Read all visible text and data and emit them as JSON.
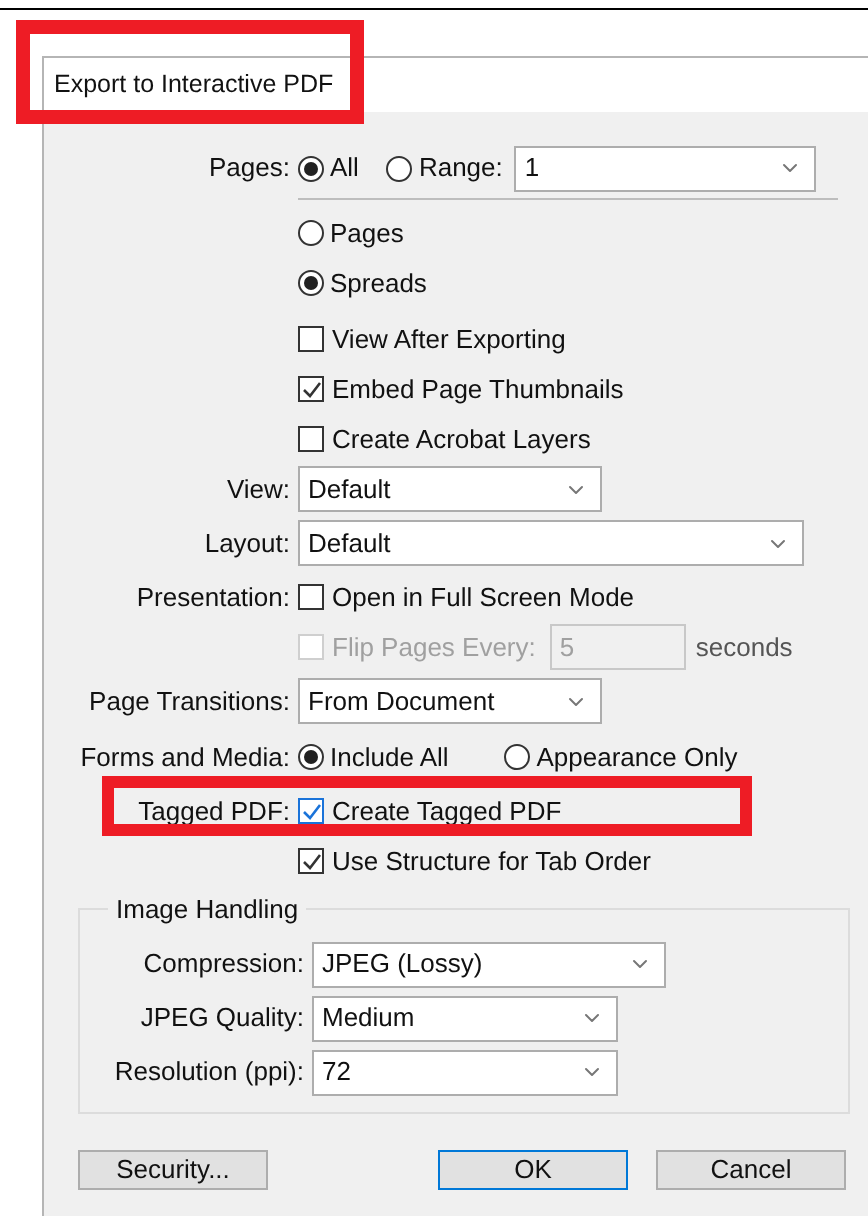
{
  "window": {
    "title": "Export to Interactive PDF",
    "highlighted": true
  },
  "pages": {
    "label": "Pages:",
    "options": [
      {
        "label": "All",
        "selected": true
      },
      {
        "label": "Range:",
        "selected": false
      }
    ],
    "range_value": "1"
  },
  "page_mode": [
    {
      "label": "Pages",
      "selected": false
    },
    {
      "label": "Spreads",
      "selected": true
    }
  ],
  "checkboxes": [
    {
      "label": "View After Exporting",
      "checked": false
    },
    {
      "label": "Embed Page Thumbnails",
      "checked": true
    },
    {
      "label": "Create Acrobat Layers",
      "checked": false
    }
  ],
  "view": {
    "label": "View:",
    "value": "Default"
  },
  "layout": {
    "label": "Layout:",
    "value": "Default"
  },
  "presentation": {
    "label": "Presentation:",
    "full_screen": {
      "label": "Open in Full Screen Mode",
      "checked": false
    },
    "flip": {
      "label": "Flip Pages Every:",
      "checked": false,
      "disabled": true,
      "value": "5",
      "unit": "seconds"
    }
  },
  "page_transitions": {
    "label": "Page Transitions:",
    "value": "From Document"
  },
  "forms_and_media": {
    "label": "Forms and Media:",
    "options": [
      {
        "label": "Include All",
        "selected": true
      },
      {
        "label": "Appearance Only",
        "selected": false
      }
    ]
  },
  "tagged_pdf": {
    "label": "Tagged PDF:",
    "highlighted": true,
    "create": {
      "label": "Create Tagged PDF",
      "checked": true,
      "focused": true
    },
    "tab_order": {
      "label": "Use Structure for Tab Order",
      "checked": true
    }
  },
  "image_handling": {
    "title": "Image Handling",
    "fields": [
      {
        "label": "Compression:",
        "value": "JPEG (Lossy)"
      },
      {
        "label": "JPEG Quality:",
        "value": "Medium"
      },
      {
        "label": "Resolution (ppi):",
        "value": "72"
      }
    ]
  },
  "buttons": [
    {
      "label": "Security...",
      "default": false
    },
    {
      "label": "OK",
      "default": true
    },
    {
      "label": "Cancel",
      "default": false
    }
  ]
}
